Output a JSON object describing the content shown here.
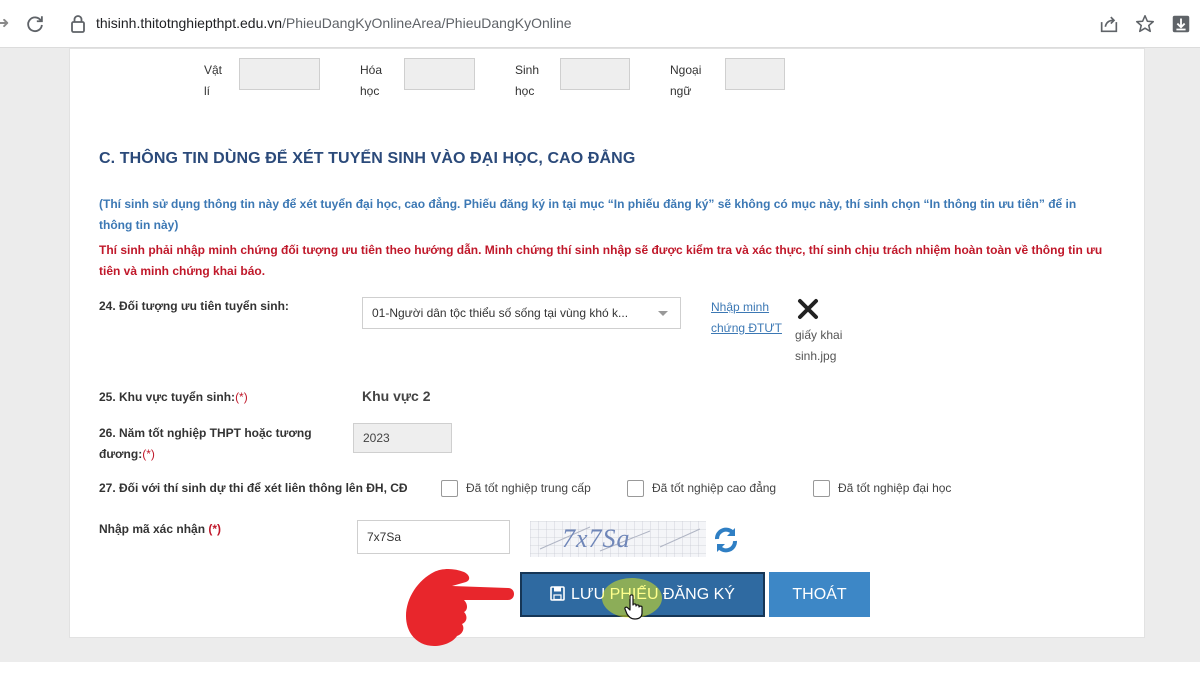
{
  "browser": {
    "url_host": "thisinh.thitotnghiepthpt.edu.vn",
    "url_path": "/PhieuDangKyOnlineArea/PhieuDangKyOnline"
  },
  "subjects": [
    {
      "line1": "Vật",
      "line2": "lí"
    },
    {
      "line1": "Hóa",
      "line2": "học"
    },
    {
      "line1": "Sinh",
      "line2": "học"
    },
    {
      "line1": "Ngoại",
      "line2": "ngữ"
    }
  ],
  "section": {
    "title": "C. THÔNG TIN DÙNG ĐỂ XÉT TUYỂN SINH VÀO ĐẠI HỌC, CAO ĐẲNG",
    "note_blue": "(Thí sinh sử dụng thông tin này để xét tuyển đại học, cao đẳng. Phiếu đăng ký in tại mục “In phiếu đăng ký” sẽ không có mục này, thí sinh chọn “In thông tin ưu tiên” để in thông tin này)",
    "note_red": "Thí sinh phải nhập minh chứng đối tượng ưu tiên theo hướng dẫn. Minh chứng thí sinh nhập sẽ được kiểm tra và xác thực, thí sinh chịu trách nhiệm hoàn toàn về thông tin ưu tiên và minh chứng khai báo."
  },
  "field24": {
    "label": "24. Đối tượng ưu tiên tuyển sinh:",
    "selected": "01-Người dân tộc thiểu số sống tại vùng khó k...",
    "link_line1": "Nhập minh",
    "link_line2": "chứng ĐTƯT",
    "file_line1": "giấy khai",
    "file_line2": "sinh.jpg"
  },
  "field25": {
    "label": "25. Khu vực tuyển sinh:",
    "required": "(*)",
    "value": "Khu vực 2"
  },
  "field26": {
    "label_line1": "26. Năm tốt nghiệp THPT hoặc tương",
    "label_line2": "đương:",
    "required": "(*)",
    "value": "2023"
  },
  "field27": {
    "label": "27. Đối với thí sinh dự thi để xét liên thông lên ĐH, CĐ",
    "options": [
      "Đã tốt nghiệp trung cấp",
      "Đã tốt nghiệp cao đẳng",
      "Đã tốt nghiệp đại học"
    ]
  },
  "captcha": {
    "label": "Nhập mã xác nhận",
    "required": "(*)",
    "input_value": "7x7Sa",
    "image_text": "7x7Sa"
  },
  "buttons": {
    "save": "LƯU PHIẾU ĐĂNG KÝ",
    "exit": "THOÁT"
  },
  "colors": {
    "save_button": "#2f6aa1",
    "exit_button": "#3d87c6",
    "note_blue": "#3c78b4",
    "note_red": "#c0182a",
    "hand_pointer": "#e8262c"
  }
}
